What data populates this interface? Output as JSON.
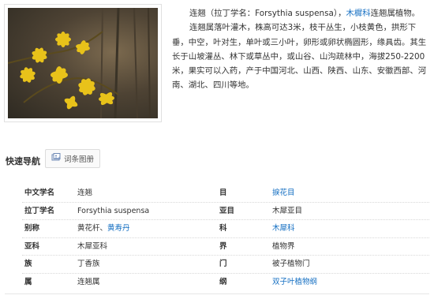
{
  "summary": {
    "line1_prefix": "连翘（拉丁学名：Forsythia suspensa），",
    "line1_link": "木樨科",
    "line1_suffix": "连翘属植物。",
    "paragraph": "连翘属落叶灌木，株高可达3米，枝干丛生，小枝黄色，拱形下垂，中空，叶对生，单叶或三小叶，卵形或卵状椭圆形，缘具齿。其生长于山坡灌丛、林下或草丛中，或山谷、山沟疏林中，海拔250-2200米，果实可以入药，产于中国河北、山西、陕西、山东、安徽西部、河南、湖北、四川等地。"
  },
  "quicknav": {
    "label": "快速导航",
    "button_label": "词条图册",
    "button_icon": "album-icon"
  },
  "info": {
    "rows": [
      {
        "lk": "中文学名",
        "lv": "连翘",
        "lv_link": "",
        "rk": "目",
        "rv": "",
        "rv_link": "捩花目"
      },
      {
        "lk": "拉丁学名",
        "lv": "Forsythia suspensa",
        "lv_link": "",
        "rk": "亚目",
        "rv": "木犀亚目",
        "rv_link": ""
      },
      {
        "lk": "别称",
        "lv": "黄花杆、",
        "lv_link": "黄寿丹",
        "rk": "科",
        "rv": "",
        "rv_link": "木犀科"
      },
      {
        "lk": "亚科",
        "lv": "木犀亚科",
        "lv_link": "",
        "rk": "界",
        "rv": "植物界",
        "rv_link": ""
      },
      {
        "lk": "族",
        "lv": "丁香族",
        "lv_link": "",
        "rk": "门",
        "rv": "被子植物门",
        "rv_link": ""
      },
      {
        "lk": "属",
        "lv": "连翘属",
        "lv_link": "",
        "rk": "纲",
        "rv": "",
        "rv_link": "双子叶植物纲"
      }
    ]
  },
  "colors": {
    "link": "#136ec2",
    "text": "#333333",
    "flower": "#e8c21a"
  }
}
